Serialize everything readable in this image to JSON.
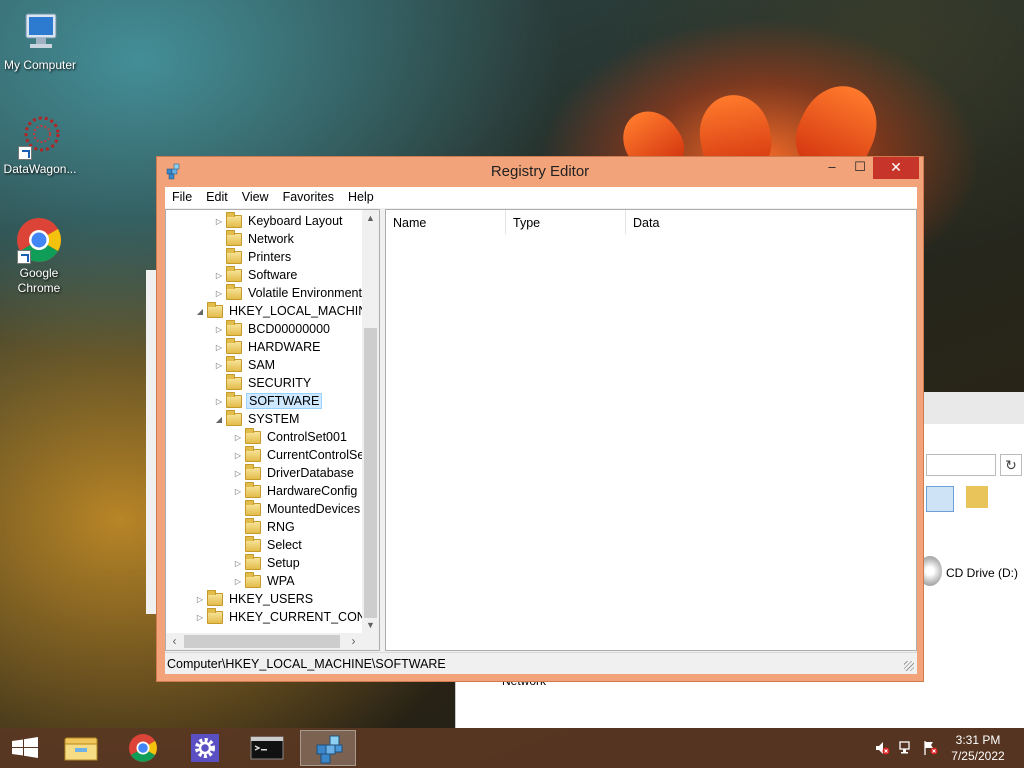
{
  "desktop": {
    "icons": [
      {
        "label": "My Computer"
      },
      {
        "label": "DataWagon..."
      },
      {
        "label": "Google Chrome"
      }
    ]
  },
  "background_window": {
    "drive_label": "CD Drive (D:)",
    "nav_label": "Network"
  },
  "regedit": {
    "title": "Registry Editor",
    "menu": [
      "File",
      "Edit",
      "View",
      "Favorites",
      "Help"
    ],
    "tree": [
      {
        "label": "Keyboard Layout",
        "expander": "▷"
      },
      {
        "label": "Network",
        "expander": ""
      },
      {
        "label": "Printers",
        "expander": ""
      },
      {
        "label": "Software",
        "expander": "▷"
      },
      {
        "label": "Volatile Environment",
        "expander": "▷"
      },
      {
        "label": "HKEY_LOCAL_MACHINE",
        "expander": "◢"
      },
      {
        "label": "BCD00000000",
        "expander": "▷"
      },
      {
        "label": "HARDWARE",
        "expander": "▷"
      },
      {
        "label": "SAM",
        "expander": "▷"
      },
      {
        "label": "SECURITY",
        "expander": ""
      },
      {
        "label": "SOFTWARE",
        "expander": "▷",
        "selected": true
      },
      {
        "label": "SYSTEM",
        "expander": "◢"
      },
      {
        "label": "ControlSet001",
        "expander": "▷"
      },
      {
        "label": "CurrentControlSet",
        "expander": "▷"
      },
      {
        "label": "DriverDatabase",
        "expander": "▷"
      },
      {
        "label": "HardwareConfig",
        "expander": "▷"
      },
      {
        "label": "MountedDevices",
        "expander": ""
      },
      {
        "label": "RNG",
        "expander": ""
      },
      {
        "label": "Select",
        "expander": ""
      },
      {
        "label": "Setup",
        "expander": "▷"
      },
      {
        "label": "WPA",
        "expander": "▷"
      },
      {
        "label": "HKEY_USERS",
        "expander": "▷"
      },
      {
        "label": "HKEY_CURRENT_CONFIG",
        "expander": "▷"
      }
    ],
    "columns": [
      "Name",
      "Type",
      "Data"
    ],
    "status": "Computer\\HKEY_LOCAL_MACHINE\\SOFTWARE"
  },
  "taskbar": {
    "time": "3:31 PM",
    "date": "7/25/2022"
  }
}
